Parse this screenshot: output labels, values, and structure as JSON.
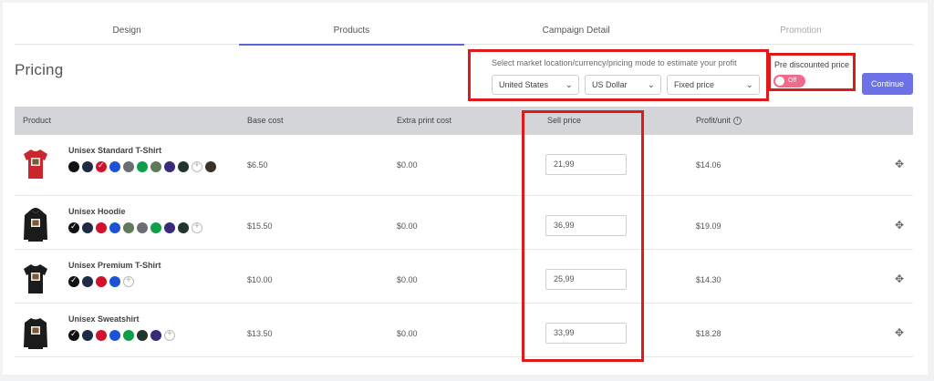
{
  "tabs": [
    {
      "label": "Design",
      "active": false
    },
    {
      "label": "Products",
      "active": true
    },
    {
      "label": "Campaign Detail",
      "active": false
    },
    {
      "label": "Promotion",
      "active": false
    }
  ],
  "page_title": "Pricing",
  "market": {
    "label": "Select market location/currency/pricing mode to estimate your profit",
    "location": "United States",
    "currency": "US Dollar",
    "mode": "Fixed price"
  },
  "pre_discount": {
    "label": "Pre discounted price",
    "toggle_label": "Off",
    "on": false
  },
  "continue_label": "Continue",
  "table": {
    "headers": [
      "Product",
      "Base cost",
      "Extra print cost",
      "Sell price",
      "Profit/unit"
    ],
    "rows": [
      {
        "name": "Unisex Standard T-Shirt",
        "garment": "tshirt",
        "garment_color": "#c9262e",
        "base_cost": "$6.50",
        "extra_cost": "$0.00",
        "sell_price": "21,99",
        "profit": "$14.06",
        "colors": [
          "#111111",
          "#1f2a44",
          "#d0132a",
          "#1b52d6",
          "#6b6e72",
          "#0f9e49",
          "#5f7a5b",
          "#3a2b7a",
          "#22352c",
          "#3a3228"
        ],
        "checked": 2
      },
      {
        "name": "Unisex Hoodie",
        "garment": "hoodie",
        "garment_color": "#1b1b1b",
        "base_cost": "$15.50",
        "extra_cost": "$0.00",
        "sell_price": "36,99",
        "profit": "$19.09",
        "colors": [
          "#111111",
          "#1f2a44",
          "#d0132a",
          "#1b52d6",
          "#5f7a5b",
          "#6b6e72",
          "#0f9e49",
          "#3a2b7a",
          "#22352c"
        ],
        "checked": 0
      },
      {
        "name": "Unisex Premium T-Shirt",
        "garment": "tshirt",
        "garment_color": "#1b1b1b",
        "base_cost": "$10.00",
        "extra_cost": "$0.00",
        "sell_price": "25,99",
        "profit": "$14.30",
        "colors": [
          "#111111",
          "#1f2a44",
          "#d0132a",
          "#1b52d6"
        ],
        "checked": 0
      },
      {
        "name": "Unisex Sweatshirt",
        "garment": "sweatshirt",
        "garment_color": "#1b1b1b",
        "base_cost": "$13.50",
        "extra_cost": "$0.00",
        "sell_price": "33,99",
        "profit": "$18.28",
        "colors": [
          "#111111",
          "#1f2a44",
          "#d0132a",
          "#1b52d6",
          "#0f9e49",
          "#22352c",
          "#3a2b7a"
        ],
        "checked": 0
      }
    ]
  },
  "colors": {
    "accent": "#6c72e6",
    "highlight": "#e0191b",
    "toggle": "#f06a8b",
    "header_bg": "#d3d5d8"
  },
  "icons": {
    "move": "move-icon",
    "info": "info-icon",
    "chevron": "chevron-down-icon",
    "add": "add-color-icon"
  }
}
